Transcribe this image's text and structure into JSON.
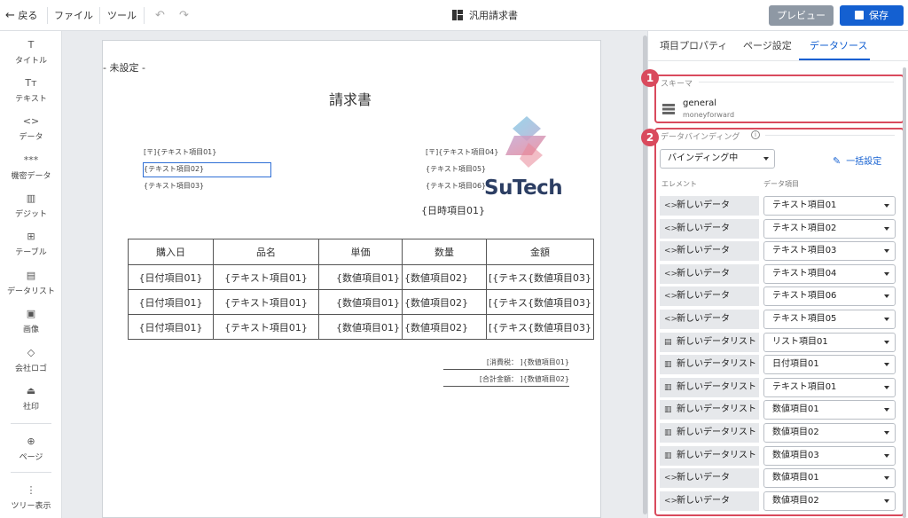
{
  "topbar": {
    "back_label": "戻る",
    "menu_file": "ファイル",
    "menu_tool": "ツール",
    "doc_title": "汎用請求書",
    "preview_label": "プレビュー",
    "save_label": "保存"
  },
  "toolbox": {
    "items": [
      {
        "icon": "title-icon",
        "glyph": "T",
        "label": "タイトル"
      },
      {
        "icon": "text-icon",
        "glyph": "Tт",
        "label": "テキスト"
      },
      {
        "icon": "code-icon",
        "glyph": "<>",
        "label": "データ"
      },
      {
        "icon": "dots-icon",
        "glyph": "***",
        "label": "機密データ"
      },
      {
        "icon": "digit-icon",
        "glyph": "▥",
        "label": "デジット"
      },
      {
        "icon": "table-icon",
        "glyph": "⊞",
        "label": "テーブル"
      },
      {
        "icon": "list-icon",
        "glyph": "▤",
        "label": "データリスト"
      },
      {
        "icon": "image-icon",
        "glyph": "▣",
        "label": "画像"
      },
      {
        "icon": "diamond-icon",
        "glyph": "◇",
        "label": "会社ロゴ"
      },
      {
        "icon": "stamp-icon",
        "glyph": "⏏",
        "label": "社印"
      },
      {
        "icon": "page-add-icon",
        "glyph": "⊕",
        "label": "ページ"
      },
      {
        "icon": "tree-icon",
        "glyph": "⋮",
        "label": "ツリー表示"
      }
    ]
  },
  "page": {
    "unset_label": "- 未設定 -",
    "title": "請求書",
    "left_fields": [
      "[〒]{テキスト項目01}",
      "{テキスト項目02}",
      "{テキスト項目03}"
    ],
    "right_fields": [
      "[〒]{テキスト項目04}",
      "{テキスト項目05}",
      "{テキスト項目06}"
    ],
    "logo_text": "SuTech",
    "date_field": "{日時項目01}",
    "table": {
      "headers": [
        "購入日",
        "品名",
        "単価",
        "数量",
        "金額"
      ],
      "rows": [
        [
          "{日付項目01}",
          "{テキスト項目01}",
          "{数値項目01}",
          "{数値項目02}",
          "[{テキス{数値項目03}"
        ],
        [
          "{日付項目01}",
          "{テキスト項目01}",
          "{数値項目01}",
          "{数値項目02}",
          "[{テキス{数値項目03}"
        ],
        [
          "{日付項目01}",
          "{テキスト項目01}",
          "{数値項目01}",
          "{数値項目02}",
          "[{テキス{数値項目03}"
        ]
      ]
    },
    "tax_line": "[消費税：  ]{数値項目01}",
    "total_line": "[合計金額：  ]{数値項目02}"
  },
  "panel": {
    "tabs": [
      "項目プロパティ",
      "ページ設定",
      "データソース"
    ],
    "active_tab": "データソース",
    "badge1": "1",
    "badge2": "2",
    "schema_section": "スキーマ",
    "schema_name": "general",
    "schema_sub": "moneyforward",
    "binding_section": "データバインディング",
    "binding_select": "バインディング中",
    "bulk_label": "一括設定",
    "col_element": "エレメント",
    "col_item": "データ項目",
    "rows": [
      {
        "icon": "code-icon",
        "glyph": "<>",
        "element": "新しいデータ",
        "item": "テキスト項目01"
      },
      {
        "icon": "code-icon",
        "glyph": "<>",
        "element": "新しいデータ",
        "item": "テキスト項目02"
      },
      {
        "icon": "code-icon",
        "glyph": "<>",
        "element": "新しいデータ",
        "item": "テキスト項目03"
      },
      {
        "icon": "code-icon",
        "glyph": "<>",
        "element": "新しいデータ",
        "item": "テキスト項目04"
      },
      {
        "icon": "code-icon",
        "glyph": "<>",
        "element": "新しいデータ",
        "item": "テキスト項目06"
      },
      {
        "icon": "code-icon",
        "glyph": "<>",
        "element": "新しいデータ",
        "item": "テキスト項目05"
      },
      {
        "icon": "list-icon",
        "glyph": "▤",
        "element": "新しいデータリスト",
        "item": "リスト項目01"
      },
      {
        "icon": "grid-icon",
        "glyph": "▥",
        "element": "新しいデータリスト",
        "item": "日付項目01"
      },
      {
        "icon": "grid-icon",
        "glyph": "▥",
        "element": "新しいデータリスト",
        "item": "テキスト項目01"
      },
      {
        "icon": "grid-icon",
        "glyph": "▥",
        "element": "新しいデータリスト",
        "item": "数値項目01"
      },
      {
        "icon": "grid-icon",
        "glyph": "▥",
        "element": "新しいデータリスト",
        "item": "数値項目02"
      },
      {
        "icon": "grid-icon",
        "glyph": "▥",
        "element": "新しいデータリスト",
        "item": "数値項目03"
      },
      {
        "icon": "code-icon",
        "glyph": "<>",
        "element": "新しいデータ",
        "item": "数値項目01"
      },
      {
        "icon": "code-icon",
        "glyph": "<>",
        "element": "新しいデータ",
        "item": "数値項目02"
      }
    ]
  },
  "colors": {
    "accent": "#1460d1",
    "highlight": "#d94a5d",
    "preview_button": "#8e98a4"
  }
}
